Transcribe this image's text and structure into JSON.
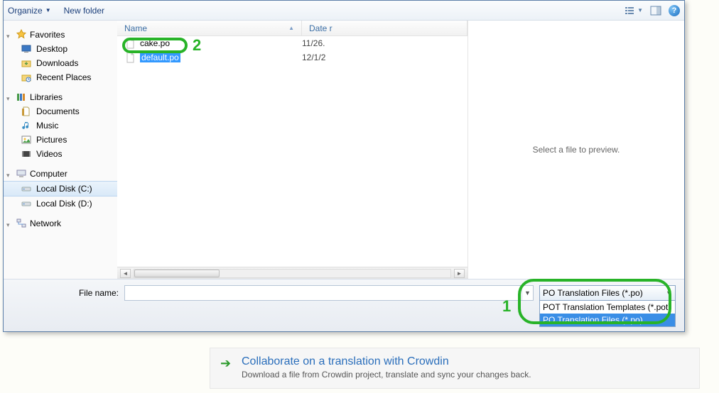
{
  "toolbar": {
    "organize": "Organize",
    "newfolder": "New folder"
  },
  "nav": {
    "favorites": {
      "label": "Favorites",
      "items": [
        "Desktop",
        "Downloads",
        "Recent Places"
      ]
    },
    "libraries": {
      "label": "Libraries",
      "items": [
        "Documents",
        "Music",
        "Pictures",
        "Videos"
      ]
    },
    "computer": {
      "label": "Computer",
      "items": [
        "Local Disk (C:)",
        "Local Disk (D:)"
      ]
    },
    "network": {
      "label": "Network"
    }
  },
  "columns": {
    "name": "Name",
    "date": "Date r"
  },
  "files": [
    {
      "name": "cake.po",
      "date": "11/26."
    },
    {
      "name": "default.po",
      "date": "12/1/2",
      "selected": true
    }
  ],
  "preview_placeholder": "Select a file to preview.",
  "filename_label": "File name:",
  "filter": {
    "current": "PO Translation Files (*.po)",
    "options": [
      "POT Translation Templates (*.pot)",
      "PO Translation Files (*.po)"
    ],
    "selected_index": 1
  },
  "annotations": {
    "file": "2",
    "filter": "1"
  },
  "promo": {
    "title": "Collaborate on a translation with Crowdin",
    "sub": "Download a file from Crowdin project, translate and sync your changes back."
  }
}
